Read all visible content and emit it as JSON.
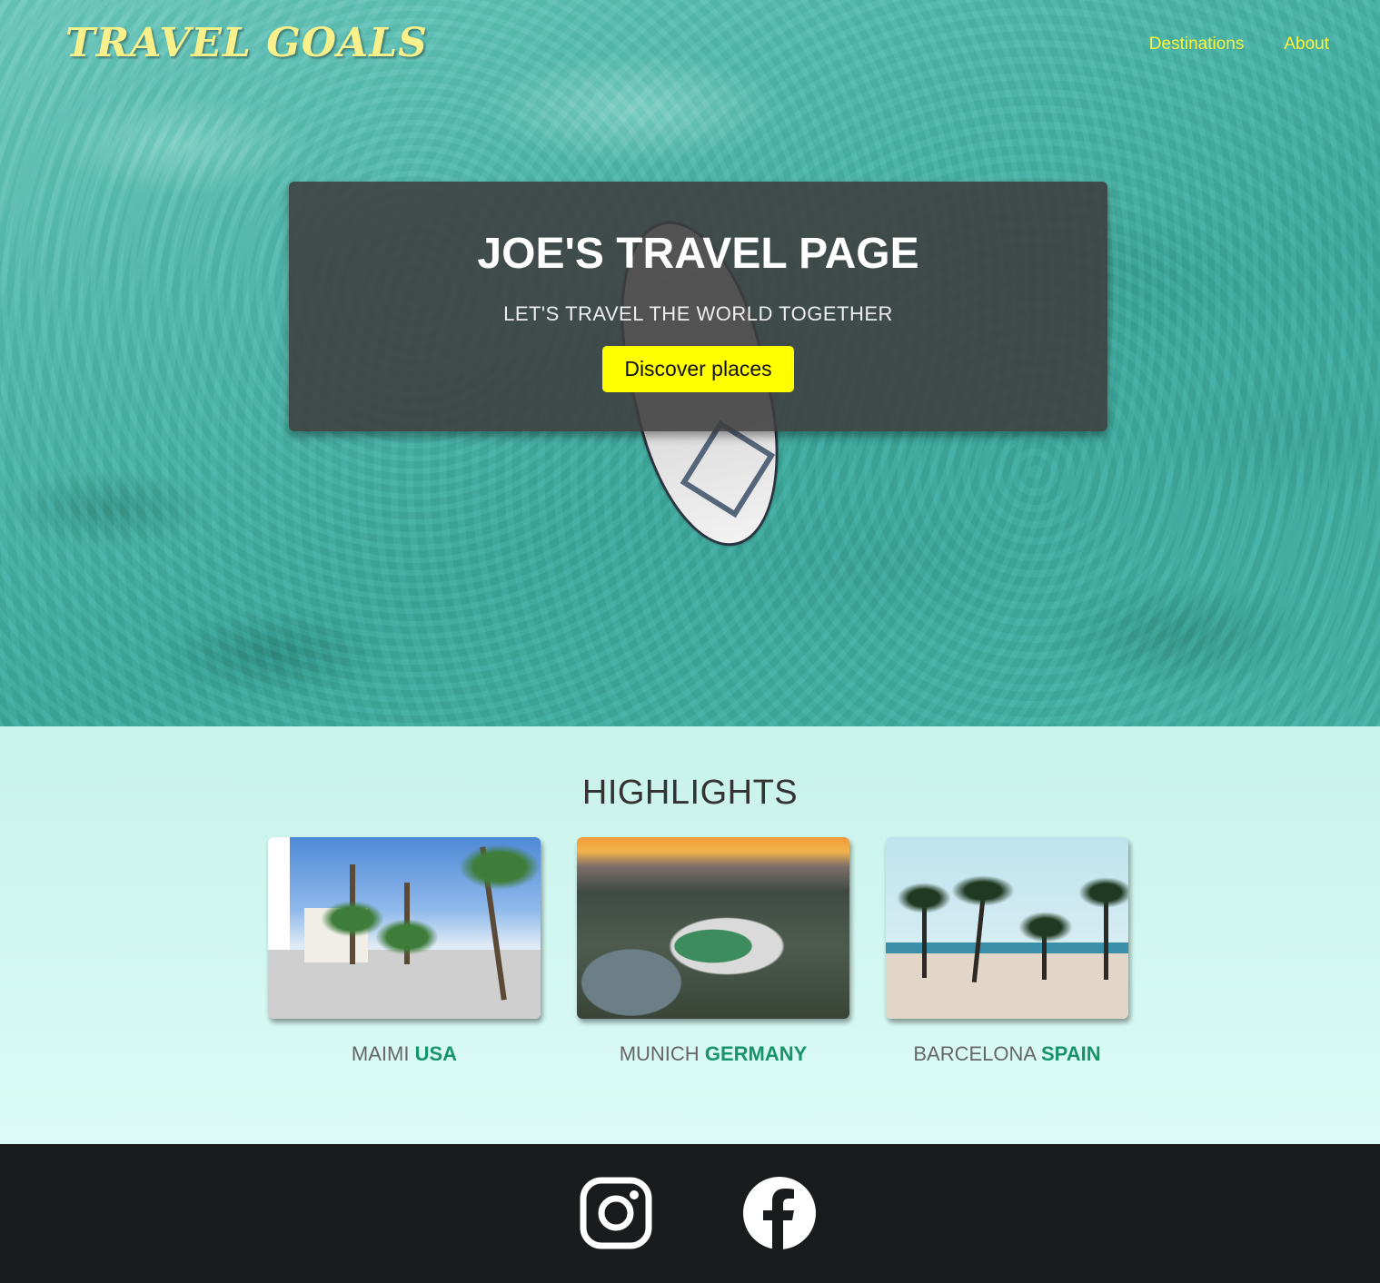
{
  "header": {
    "logo": "TRAVEL GOALS",
    "nav": [
      {
        "label": "Destinations"
      },
      {
        "label": "About"
      }
    ]
  },
  "hero": {
    "title": "JOE'S TRAVEL PAGE",
    "subtitle": "LET'S TRAVEL THE WORLD TOGETHER",
    "button_label": "Discover places"
  },
  "highlights": {
    "heading": "HIGHLIGHTS",
    "items": [
      {
        "city": "MAIMI",
        "country": "USA"
      },
      {
        "city": "MUNICH",
        "country": "GERMANY"
      },
      {
        "city": "BARCELONA",
        "country": "SPAIN"
      }
    ]
  },
  "footer": {
    "icons": [
      "instagram-icon",
      "facebook-icon"
    ]
  },
  "colors": {
    "logo": "#f8f08a",
    "nav_link": "#fbf53a",
    "button_bg": "#ffff00",
    "country_accent": "#18946a",
    "footer_bg": "#1a1b1c"
  }
}
